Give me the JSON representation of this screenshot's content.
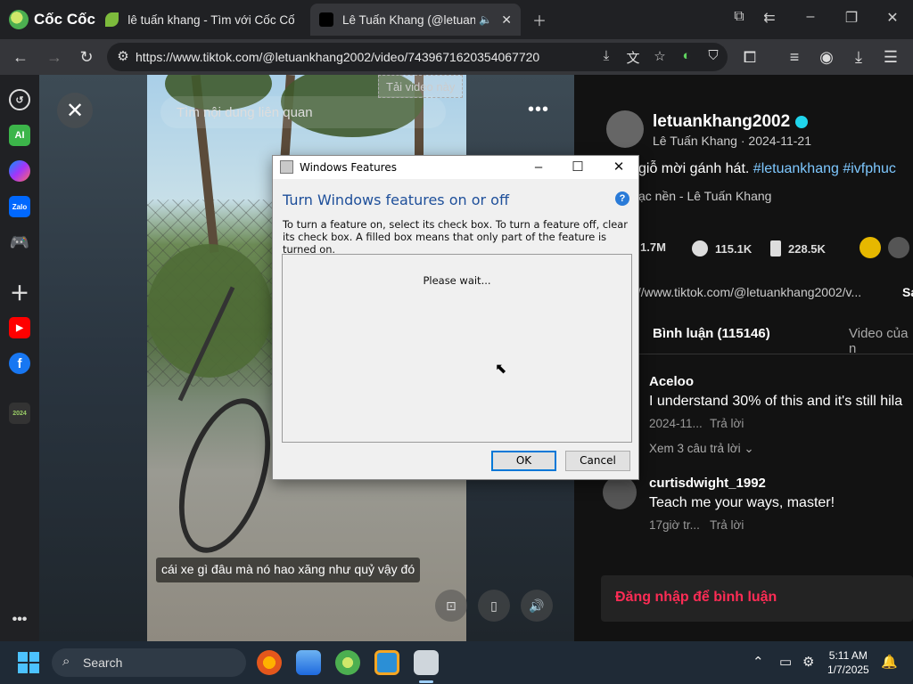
{
  "browser": {
    "brand": "Cốc Cốc",
    "tabs": [
      {
        "title": "lê tuấn khang - Tìm với Cốc Cốc",
        "active": false
      },
      {
        "title": "Lê Tuấn Khang (@letuanl",
        "active": true
      }
    ],
    "url": "https://www.tiktok.com/@letuankhang2002/video/7439671620354067720"
  },
  "sidebar": {
    "items": [
      "history-icon",
      "ai-icon",
      "messenger-icon",
      "zalo-icon",
      "games-icon",
      "add-icon",
      "youtube-icon",
      "facebook-icon",
      "coccoc-2024-icon",
      "more-icon"
    ],
    "ai_label": "AI",
    "zalo_label": "Zalo",
    "coccoc_year": "2024"
  },
  "video": {
    "search_placeholder": "Tìm nội dung liên quan",
    "download_label": "Tải video này",
    "subtitle": "cái xe gì đâu mà nó hao xăng như quỷ vậy đó"
  },
  "post": {
    "username": "letuankhang2002",
    "display_meta": "Lê Tuấn Khang · 2024-11-21",
    "caption_text": "giỗ mời gánh hát. ",
    "caption_tags": "#letuankhang #ivfphuc",
    "music": "ạc nền - Lê Tuấn Khang",
    "stats": {
      "likes": "1.7M",
      "comments": "115.1K",
      "saves": "228.5K"
    },
    "link": "s://www.tiktok.com/@letuankhang2002/v...",
    "link_suffix": "Sa",
    "tabs": [
      "Bình luận (115146)",
      "Video của n"
    ],
    "comments": [
      {
        "name": "Aceloo",
        "text": "I understand 30% of this and it's still hila",
        "date": "2024-11...",
        "reply": "Trả lời",
        "more": "Xem 3 câu trả lời"
      },
      {
        "name": "curtisdwight_1992",
        "text": "Teach me your ways, master!",
        "date": "17giờ tr...",
        "reply": "Trả lời"
      }
    ],
    "login_prompt": "Đăng nhập để bình luận"
  },
  "dialog": {
    "title": "Windows Features",
    "heading": "Turn Windows features on or off",
    "description": "To turn a feature on, select its check box. To turn a feature off, clear its check box. A filled box means that only part of the feature is turned on.",
    "status": "Please wait...",
    "ok_label": "OK",
    "cancel_label": "Cancel"
  },
  "taskbar": {
    "search_label": "Search",
    "time": "5:11 AM",
    "date": "1/7/2025"
  },
  "colors": {
    "accent_tiktok": "#fe2c55",
    "hashtag": "#7ec8ff",
    "dialog_heading": "#1e4f9a"
  }
}
